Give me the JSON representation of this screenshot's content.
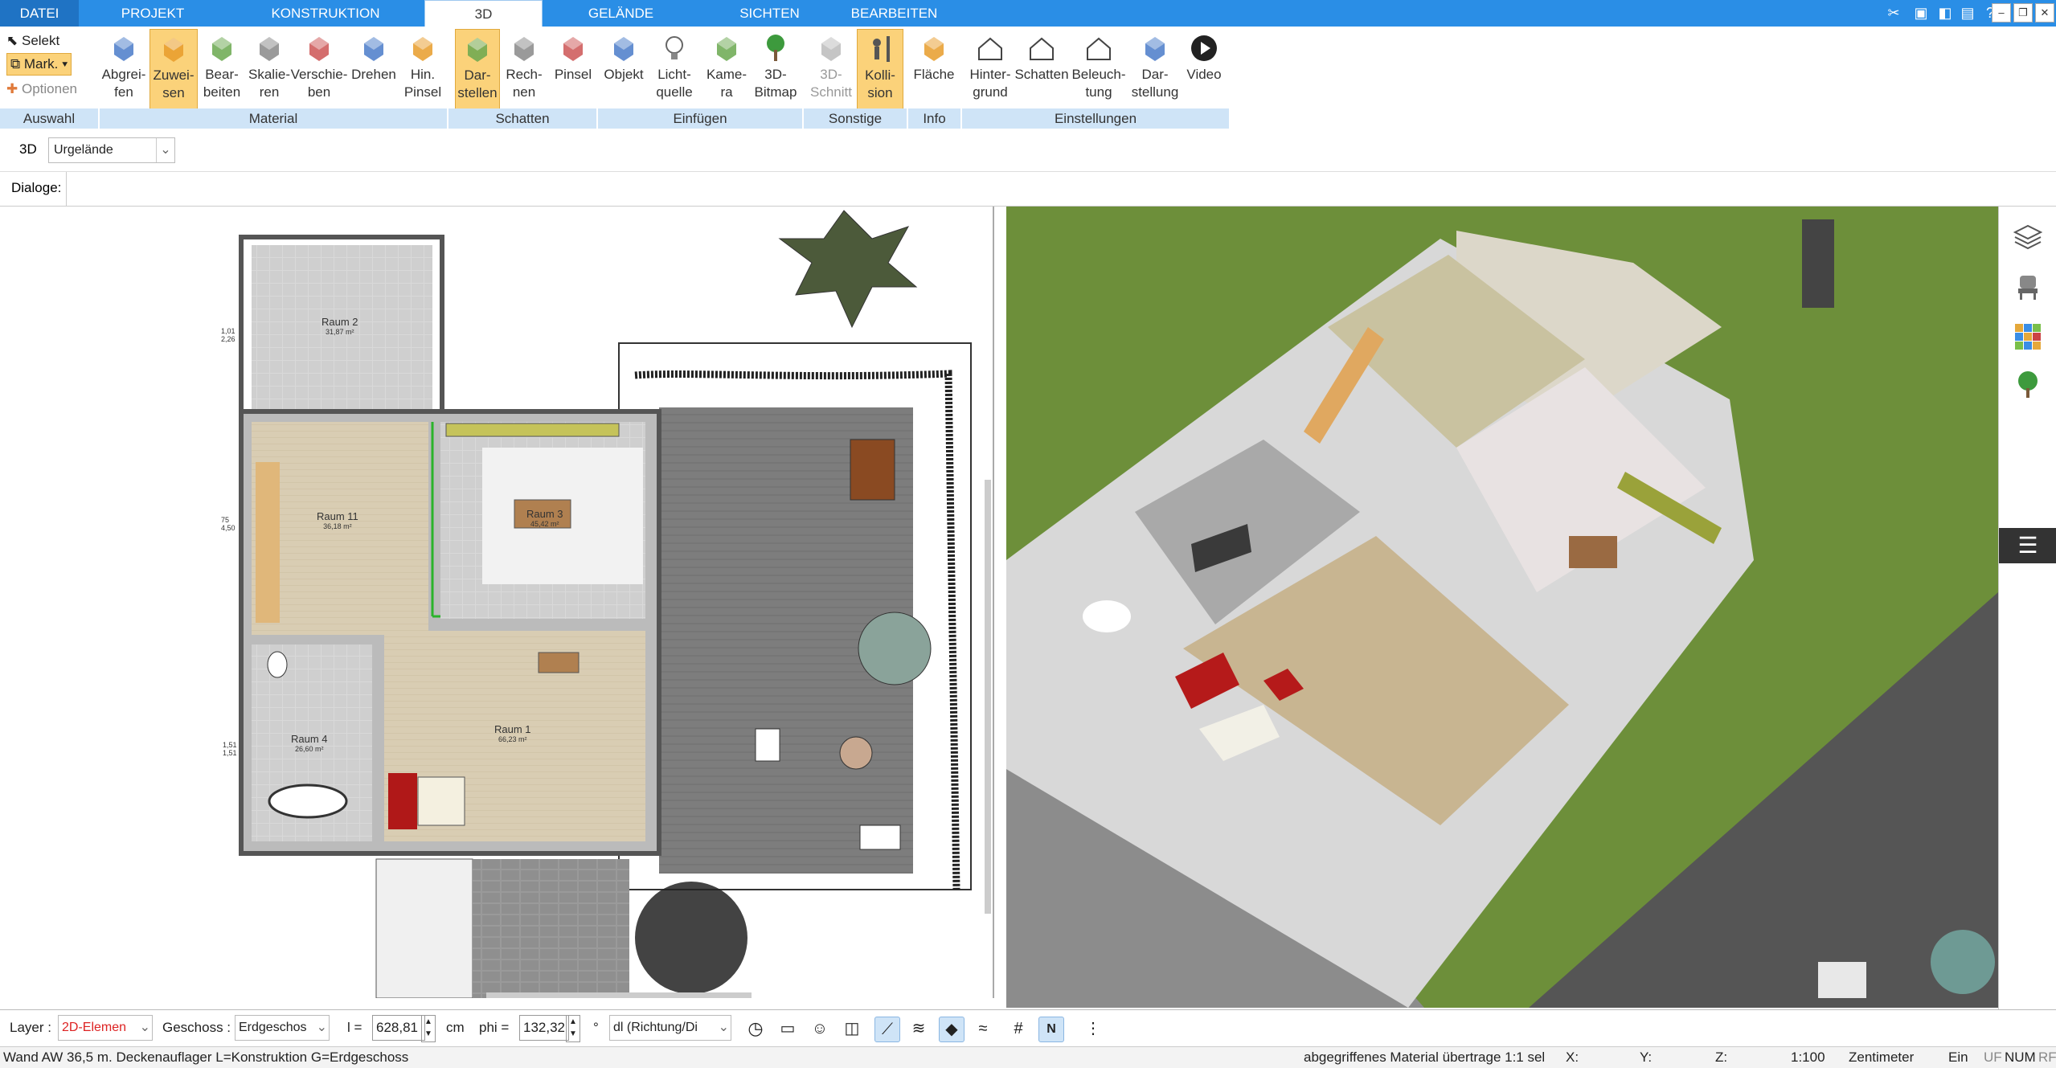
{
  "tabs": [
    {
      "label": "DATEI"
    },
    {
      "label": "PROJEKT"
    },
    {
      "label": "KONSTRUKTION"
    },
    {
      "label": "3D"
    },
    {
      "label": "GELÄNDE"
    },
    {
      "label": "SICHTEN"
    },
    {
      "label": "BEARBEITEN"
    }
  ],
  "ribbon": {
    "auswahl": {
      "selekt": "Selekt",
      "mark": "Mark.",
      "optionen": "Optionen",
      "group": "Auswahl"
    },
    "buttons": [
      {
        "label": "Abgrei-\nfen",
        "icon": "eyedropper-icon"
      },
      {
        "label": "Zuwei-\nsen",
        "icon": "assign-material-icon"
      },
      {
        "label": "Bear-\nbeiten",
        "icon": "edit-material-icon"
      },
      {
        "label": "Skalie-\nren",
        "icon": "scale-icon"
      },
      {
        "label": "Verschie-\nben",
        "icon": "move-icon"
      },
      {
        "label": "Drehen",
        "icon": "rotate-icon"
      },
      {
        "label": "Hin.\nPinsel",
        "icon": "brush-icon"
      },
      {
        "label": "Dar-\nstellen",
        "icon": "shadow-display-icon"
      },
      {
        "label": "Rech-\nnen",
        "icon": "shadow-calc-icon"
      },
      {
        "label": "Pinsel",
        "icon": "shadow-brush-icon"
      },
      {
        "label": "Objekt",
        "icon": "chair-icon"
      },
      {
        "label": "Licht-\nquelle",
        "icon": "lightbulb-icon"
      },
      {
        "label": "Kame-\nra",
        "icon": "camera-icon"
      },
      {
        "label": "3D-\nBitmap",
        "icon": "tree-icon"
      },
      {
        "label": "3D-\nSchnitt",
        "icon": "section-icon"
      },
      {
        "label": "Kolli-\nsion",
        "icon": "collision-icon"
      },
      {
        "label": "Fläche",
        "icon": "area-info-icon"
      },
      {
        "label": "Hinter-\ngrund",
        "icon": "background-icon"
      },
      {
        "label": "Schatten",
        "icon": "shadow-house-icon"
      },
      {
        "label": "Beleuch-\ntung",
        "icon": "lighting-house-icon"
      },
      {
        "label": "Dar-\nstellung",
        "icon": "display-settings-icon"
      },
      {
        "label": "Video",
        "icon": "play-icon"
      }
    ],
    "groups": [
      "Material",
      "Schatten",
      "Einfügen",
      "Sonstige",
      "Info",
      "Einstellungen"
    ]
  },
  "row2": {
    "mode": "3D",
    "terrain": "Urgelände"
  },
  "row3": {
    "dialoge": "Dialoge:"
  },
  "plan": {
    "rooms": [
      {
        "name": "Raum 2",
        "area": "31,87 m²"
      },
      {
        "name": "Raum 11",
        "area": "36,18 m²"
      },
      {
        "name": "Raum 3",
        "area": "45,42 m²"
      },
      {
        "name": "Raum 4",
        "area": "26,60 m²"
      },
      {
        "name": "Raum 1",
        "area": "66,23 m²"
      }
    ],
    "dims": [
      "1,01",
      "2,26",
      "75",
      "4,50",
      "1,51",
      "1,51"
    ]
  },
  "bottom": {
    "layer_label": "Layer :",
    "layer_value": "2D-Elemen",
    "geschoss_label": "Geschoss :",
    "geschoss_value": "Erdgeschos",
    "l_label": "l =",
    "l_value": "628,81",
    "l_unit": "cm",
    "phi_label": "phi =",
    "phi_value": "132,32",
    "phi_unit": "°",
    "dl_value": "dl (Richtung/Di"
  },
  "status": {
    "left": "Wand AW 36,5 m. Deckenauflager L=Konstruktion G=Erdgeschoss",
    "material": "abgegriffenes Material übertrage 1:1 sel",
    "x": "X:",
    "y": "Y:",
    "z": "Z:",
    "scale": "1:100",
    "unit": "Zentimeter",
    "ein": "Ein",
    "uf": "UF",
    "num": "NUM",
    "rf": "RF"
  },
  "colors": {
    "accent": "#2a8ee6",
    "selected": "#fbd27a",
    "group": "#cfe4f7"
  }
}
